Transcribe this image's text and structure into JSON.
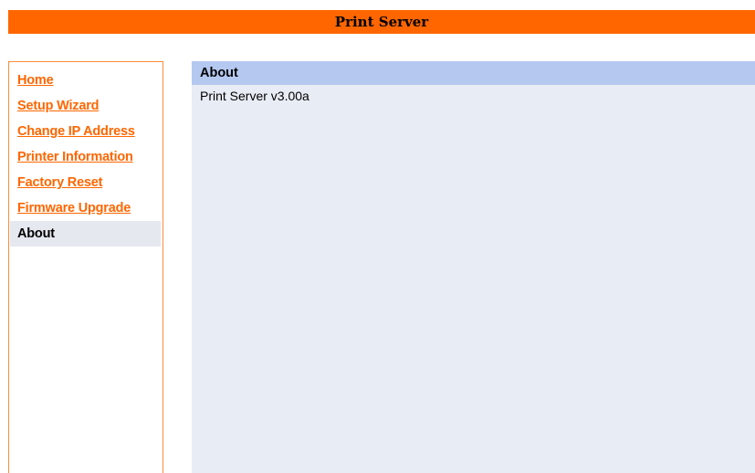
{
  "header": {
    "title": "Print Server"
  },
  "sidebar": {
    "items": [
      {
        "label": "Home"
      },
      {
        "label": "Setup Wizard"
      },
      {
        "label": "Change IP Address"
      },
      {
        "label": "Printer Information"
      },
      {
        "label": "Factory Reset"
      },
      {
        "label": "Firmware Upgrade"
      },
      {
        "label": "About"
      }
    ],
    "active_label": "About"
  },
  "main": {
    "title": "About",
    "version_text": "Print Server v3.00a"
  },
  "colors": {
    "header_bg": "#ff6600",
    "link": "#ff6600",
    "sidebar_border": "#ff8c3c",
    "panel_title_bg": "#b4c8f0",
    "panel_bg": "#e8ecf4",
    "active_item_bg": "#e6e8f0"
  }
}
